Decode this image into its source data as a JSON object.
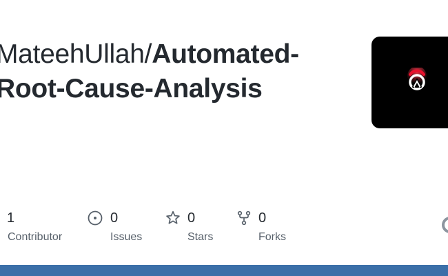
{
  "repo": {
    "owner": "MateehUllah/",
    "name_line1": "Automated-",
    "name_line2": "Root-Cause-Analysis"
  },
  "avatar": {
    "icon": "overwatch-logo-icon",
    "background": "#000000",
    "accent": "#e8112d"
  },
  "stats": {
    "contributors": {
      "value": "1",
      "label": "Contributor"
    },
    "issues": {
      "value": "0",
      "label": "Issues",
      "icon": "issue-circle-icon"
    },
    "stars": {
      "value": "0",
      "label": "Stars",
      "icon": "star-icon"
    },
    "forks": {
      "value": "0",
      "label": "Forks",
      "icon": "fork-icon"
    }
  },
  "colors": {
    "text": "#24292f",
    "muted": "#57606a",
    "bar": "#3b6fa8"
  }
}
